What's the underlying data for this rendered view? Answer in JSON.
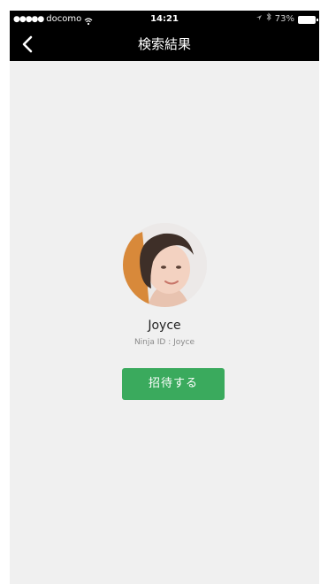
{
  "status_bar": {
    "signal": "●●●●●",
    "carrier": "docomo",
    "time": "14:21",
    "battery_percent": "73%",
    "wifi_icon": "wifi-icon",
    "location_icon": "location-arrow-icon",
    "bluetooth_icon": "bluetooth-icon",
    "battery_icon": "battery-icon"
  },
  "nav": {
    "title": "検索結果",
    "back_icon": "chevron-left-icon"
  },
  "profile": {
    "name": "Joyce",
    "ninja_id": "Ninja ID : Joyce"
  },
  "actions": {
    "invite_label": "招待する"
  },
  "colors": {
    "nav_background": "#000000",
    "page_background": "#f0f0f0",
    "invite_button": "#3aaa5d"
  }
}
